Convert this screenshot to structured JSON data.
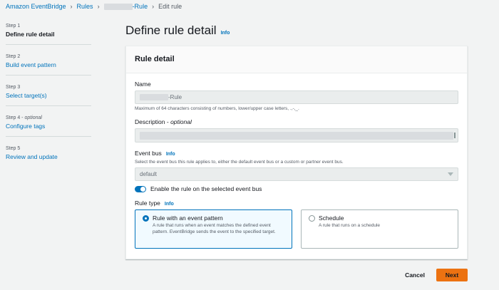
{
  "breadcrumb": {
    "root": "Amazon EventBridge",
    "rules": "Rules",
    "rule_suffix": "-Rule",
    "current": "Edit rule"
  },
  "steps": [
    {
      "num": "Step 1",
      "optional": "",
      "title": "Define rule detail"
    },
    {
      "num": "Step 2",
      "optional": "",
      "title": "Build event pattern"
    },
    {
      "num": "Step 3",
      "optional": "",
      "title": "Select target(s)"
    },
    {
      "num": "Step 4 - ",
      "optional": "optional",
      "title": "Configure tags"
    },
    {
      "num": "Step 5",
      "optional": "",
      "title": "Review and update"
    }
  ],
  "page": {
    "title": "Define rule detail",
    "info": "Info"
  },
  "card": {
    "header": "Rule detail",
    "name": {
      "label": "Name",
      "value_suffix": "-Rule",
      "hint": "Maximum of 64 characters consisting of numbers, lower/upper case letters, .,-,_."
    },
    "description": {
      "label": "Description - ",
      "optional": "optional"
    },
    "event_bus": {
      "label": "Event bus",
      "info": "Info",
      "hint": "Select the event bus this rule applies to, either the default event bus or a custom or partner event bus.",
      "value": "default"
    },
    "toggle": {
      "label": "Enable the rule on the selected event bus",
      "enabled": true
    },
    "rule_type": {
      "label": "Rule type",
      "info": "Info",
      "options": [
        {
          "title": "Rule with an event pattern",
          "desc": "A rule that runs when an event matches the defined event pattern. EventBridge sends the event to the specified target.",
          "selected": true
        },
        {
          "title": "Schedule",
          "desc": "A rule that runs on a schedule",
          "selected": false
        }
      ]
    }
  },
  "footer": {
    "cancel": "Cancel",
    "next": "Next"
  },
  "colors": {
    "link": "#0073bb",
    "primary_button": "#ec7211",
    "background": "#f2f3f3"
  }
}
